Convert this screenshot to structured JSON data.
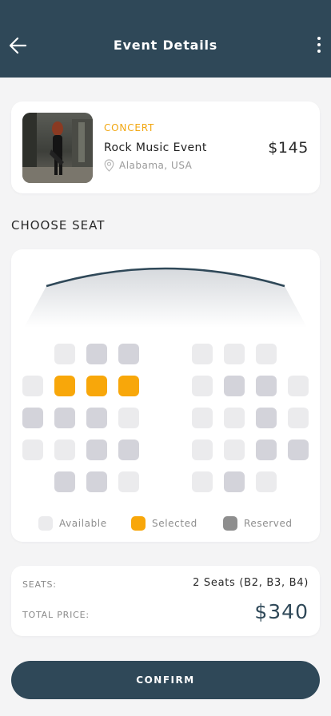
{
  "header": {
    "title": "Event Details",
    "back_icon": "arrow-left-icon",
    "more_icon": "more-vertical-icon"
  },
  "event": {
    "category": "CONCERT",
    "title": "Rock Music Event",
    "location": "Alabama, USA",
    "price": "$145",
    "image_icon": "event-photo"
  },
  "seat_section": {
    "title": "CHOOSE SEAT"
  },
  "seat_map": {
    "left_block": [
      [
        null,
        "available",
        "reserved",
        "reserved"
      ],
      [
        "available",
        "selected",
        "selected",
        "selected"
      ],
      [
        "reserved",
        "reserved",
        "reserved",
        "available"
      ],
      [
        "available",
        "available",
        "reserved",
        "reserved"
      ],
      [
        null,
        "reserved",
        "reserved",
        "available"
      ]
    ],
    "right_block": [
      [
        "available",
        "available",
        "available",
        null
      ],
      [
        "available",
        "reserved",
        "reserved",
        "available"
      ],
      [
        "available",
        "available",
        "reserved",
        "available"
      ],
      [
        "available",
        "available",
        "reserved",
        "reserved"
      ],
      [
        "available",
        "reserved",
        "available",
        null
      ]
    ]
  },
  "legend": {
    "available": "Available",
    "selected": "Selected",
    "reserved": "Reserved"
  },
  "summary": {
    "seats_label": "SEATS:",
    "seats_value": "2 Seats (B2, B3, B4)",
    "total_label": "TOTAL PRICE:",
    "total_value": "$340"
  },
  "confirm_label": "CONFIRM",
  "colors": {
    "primary": "#2f4858",
    "accent": "#f8a70a",
    "available": "#ebebed",
    "reserved": "#d3d3da",
    "legend_reserved": "#8e8e8e"
  }
}
